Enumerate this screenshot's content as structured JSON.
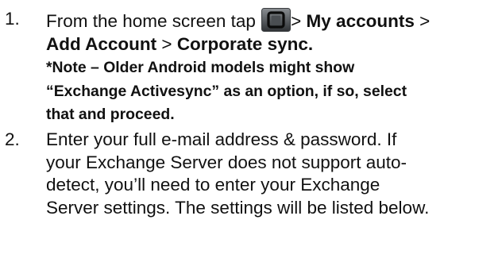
{
  "steps": [
    {
      "number": "1.",
      "prefix": "From the home screen tap",
      "icon": "home-button-icon",
      "separator_1": "> ",
      "menu_1": "My accounts",
      "separator_2": " >",
      "menu_2": "Add Account",
      "separator_3": " > ",
      "menu_3": "Corporate sync.",
      "note_line_1": "*Note – Older Android models might show",
      "note_line_2": "“Exchange Activesync” as an option, if so, select",
      "note_line_3": "that and proceed."
    },
    {
      "number": "2.",
      "line_1": "Enter your full e-mail address & password. If",
      "line_2": "your Exchange Server does not support auto-",
      "line_3": "detect, you’ll need to enter your Exchange",
      "line_4": "Server settings. The settings will be listed below."
    }
  ]
}
